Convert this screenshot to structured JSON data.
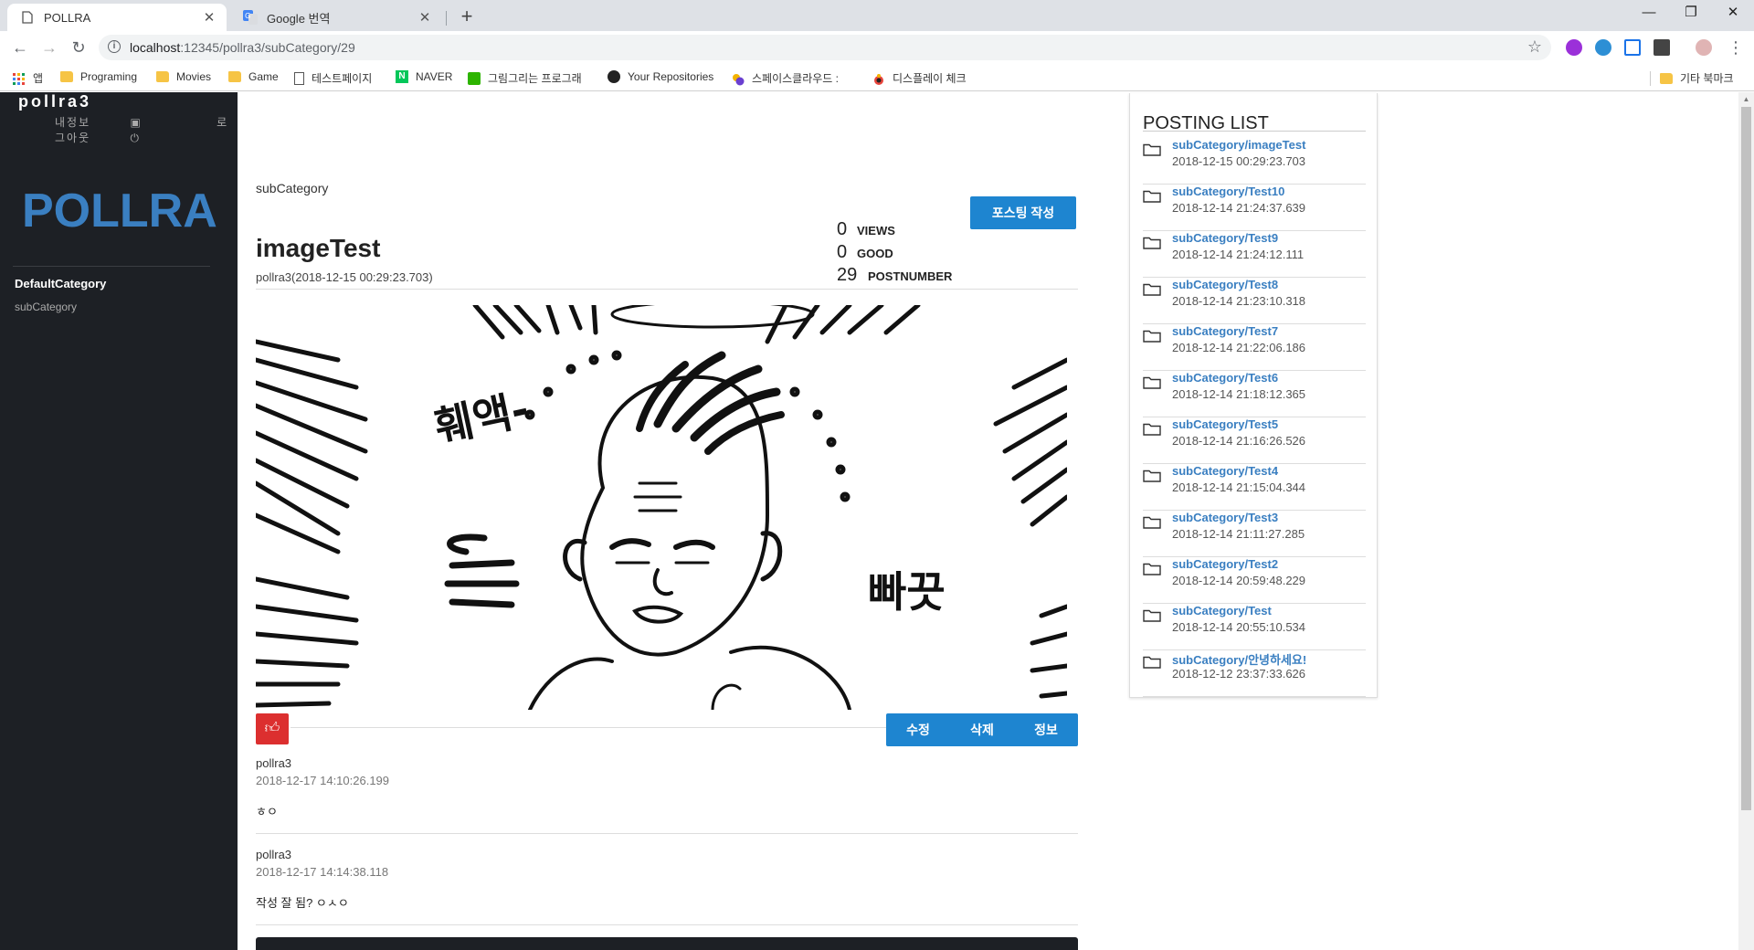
{
  "browser": {
    "tabs": [
      {
        "title": "POLLRA",
        "active": true
      },
      {
        "title": "Google 번역",
        "active": false
      }
    ],
    "url_host": "localhost",
    "url_path": ":12345/pollra3/subCategory/29",
    "bookmarks": [
      {
        "label": "앱",
        "icon": "apps-grid-icon"
      },
      {
        "label": "Programing",
        "icon": "folder-icon"
      },
      {
        "label": "Movies",
        "icon": "folder-icon"
      },
      {
        "label": "Game",
        "icon": "folder-icon"
      },
      {
        "label": "테스트페이지",
        "icon": "page-icon"
      },
      {
        "label": "NAVER",
        "icon": "naver-icon"
      },
      {
        "label": "그림그리는 프로그래",
        "icon": "blog-icon"
      },
      {
        "label": "Your Repositories",
        "icon": "github-icon"
      },
      {
        "label": "스페이스클라우드 :",
        "icon": "spacecloud-icon"
      },
      {
        "label": "디스플레이 체크",
        "icon": "display-check-icon"
      }
    ],
    "other_bookmarks": "기타 북마크"
  },
  "sidebar": {
    "username": "pollra3",
    "my_info": "내정보",
    "logout": "로그아웃",
    "brand": "POLLRA",
    "category": "DefaultCategory",
    "subcategory": "subCategory"
  },
  "post": {
    "breadcrumb": "subCategory",
    "write_button": "포스팅 작성",
    "title": "imageTest",
    "meta": "pollra3(2018-12-15 00:29:23.703)",
    "stats": [
      {
        "value": "0",
        "label": "VIEWS"
      },
      {
        "value": "0",
        "label": "GOOD"
      },
      {
        "value": "29",
        "label": "POSTNUMBER"
      }
    ],
    "image_text_left": "훼액-",
    "image_text_right": "빠끗",
    "actions": {
      "edit": "수정",
      "delete": "삭제",
      "info": "정보"
    }
  },
  "comments": [
    {
      "user": "pollra3",
      "time": "2018-12-17 14:10:26.199",
      "body": "ㅎㅇ"
    },
    {
      "user": "pollra3",
      "time": "2018-12-17 14:14:38.118",
      "body": "작성 잘 됨? ㅇㅅㅇ"
    }
  ],
  "posting_list": {
    "title": "POSTING LIST",
    "items": [
      {
        "link": "subCategory/imageTest",
        "date": "2018-12-15 00:29:23.703"
      },
      {
        "link": "subCategory/Test10",
        "date": "2018-12-14 21:24:37.639"
      },
      {
        "link": "subCategory/Test9",
        "date": "2018-12-14 21:24:12.111"
      },
      {
        "link": "subCategory/Test8",
        "date": "2018-12-14 21:23:10.318"
      },
      {
        "link": "subCategory/Test7",
        "date": "2018-12-14 21:22:06.186"
      },
      {
        "link": "subCategory/Test6",
        "date": "2018-12-14 21:18:12.365"
      },
      {
        "link": "subCategory/Test5",
        "date": "2018-12-14 21:16:26.526"
      },
      {
        "link": "subCategory/Test4",
        "date": "2018-12-14 21:15:04.344"
      },
      {
        "link": "subCategory/Test3",
        "date": "2018-12-14 21:11:27.285"
      },
      {
        "link": "subCategory/Test2",
        "date": "2018-12-14 20:59:48.229"
      },
      {
        "link": "subCategory/Test",
        "date": "2018-12-14 20:55:10.534"
      },
      {
        "link": "subCategory/안녕하세요!",
        "date": "2018-12-12 23:37:33.626"
      }
    ]
  },
  "colors": {
    "brand_blue": "#3a7fc1",
    "button_blue": "#1e85d0",
    "like_red": "#dc2f2f",
    "sidebar_bg": "#1d2025"
  }
}
